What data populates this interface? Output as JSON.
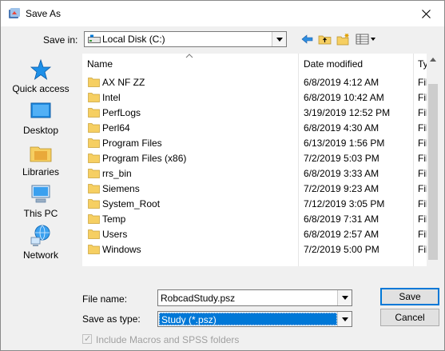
{
  "window": {
    "title": "Save As"
  },
  "toolbar": {
    "save_in_label": "Save in:",
    "location": "Local Disk (C:)",
    "icons": [
      "back-arrow-icon",
      "up-folder-icon",
      "new-folder-icon",
      "view-menu-icon"
    ]
  },
  "places": [
    {
      "label": "Quick access",
      "icon": "quick-access-star-icon"
    },
    {
      "label": "Desktop",
      "icon": "desktop-icon"
    },
    {
      "label": "Libraries",
      "icon": "libraries-icon"
    },
    {
      "label": "This PC",
      "icon": "this-pc-icon"
    },
    {
      "label": "Network",
      "icon": "network-icon"
    }
  ],
  "file_list": {
    "columns": [
      "Name",
      "Date modified",
      "Ty"
    ],
    "rows": [
      {
        "name": "AX NF ZZ",
        "date": "6/8/2019 4:12 AM",
        "type": "Fil"
      },
      {
        "name": "Intel",
        "date": "6/8/2019 10:42 AM",
        "type": "Fil"
      },
      {
        "name": "PerfLogs",
        "date": "3/19/2019 12:52 PM",
        "type": "Fil"
      },
      {
        "name": "Perl64",
        "date": "6/8/2019 4:30 AM",
        "type": "Fil"
      },
      {
        "name": "Program Files",
        "date": "6/13/2019 1:56 PM",
        "type": "Fil"
      },
      {
        "name": "Program Files (x86)",
        "date": "7/2/2019 5:03 PM",
        "type": "Fil"
      },
      {
        "name": "rrs_bin",
        "date": "6/8/2019 3:33 AM",
        "type": "Fil"
      },
      {
        "name": "Siemens",
        "date": "7/2/2019 9:23 AM",
        "type": "Fil"
      },
      {
        "name": "System_Root",
        "date": "7/12/2019 3:05 PM",
        "type": "Fil"
      },
      {
        "name": "Temp",
        "date": "6/8/2019 7:31 AM",
        "type": "Fil"
      },
      {
        "name": "Users",
        "date": "6/8/2019 2:57 AM",
        "type": "Fil"
      },
      {
        "name": "Windows",
        "date": "7/2/2019 5:00 PM",
        "type": "Fil"
      }
    ]
  },
  "form": {
    "file_name_label": "File name:",
    "file_name_value": "RobcadStudy.psz",
    "save_as_type_label": "Save as type:",
    "save_as_type_value": "Study (*.psz)"
  },
  "buttons": {
    "save": "Save",
    "cancel": "Cancel"
  },
  "options": {
    "macros_label": "Include Macros and SPSS folders",
    "macros_checked": true
  },
  "colors": {
    "selection": "#0078d7",
    "folder": "#f6cf62",
    "accent": "#0078d7"
  }
}
